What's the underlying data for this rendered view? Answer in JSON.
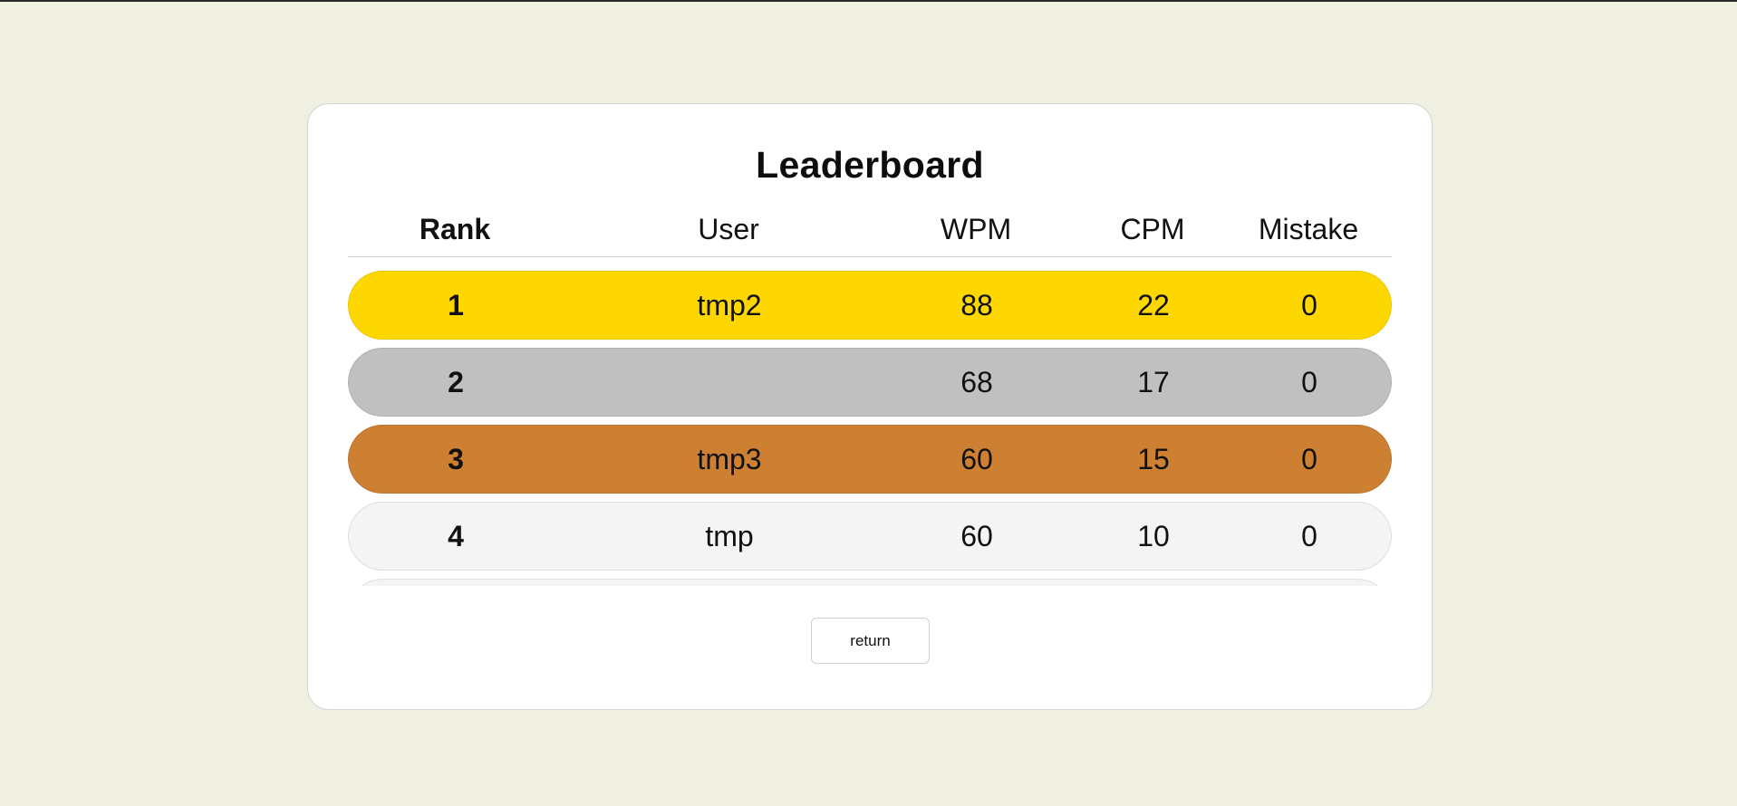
{
  "leaderboard": {
    "title": "Leaderboard",
    "columns": {
      "rank": "Rank",
      "user": "User",
      "wpm": "WPM",
      "cpm": "CPM",
      "mistake": "Mistake"
    },
    "rows": [
      {
        "rank": "1",
        "user": "tmp2",
        "wpm": "88",
        "cpm": "22",
        "mistake": "0",
        "color": "#ffd700"
      },
      {
        "rank": "2",
        "user": "",
        "wpm": "68",
        "cpm": "17",
        "mistake": "0",
        "color": "#c0c0c0"
      },
      {
        "rank": "3",
        "user": "tmp3",
        "wpm": "60",
        "cpm": "15",
        "mistake": "0",
        "color": "#cd7f32"
      },
      {
        "rank": "4",
        "user": "tmp",
        "wpm": "60",
        "cpm": "10",
        "mistake": "0",
        "color": "#f4f4f4"
      },
      {
        "rank": "",
        "user": "",
        "wpm": "",
        "cpm": "",
        "mistake": "",
        "color": "#f4f4f4"
      }
    ]
  },
  "actions": {
    "return_label": "return"
  }
}
